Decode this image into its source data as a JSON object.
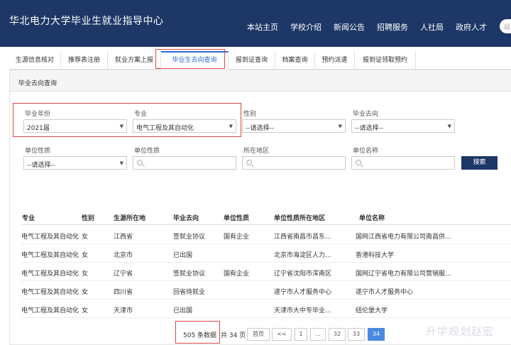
{
  "header": {
    "title": "华北电力大学毕业生就业指导中心",
    "nav": [
      "本站主页",
      "学校介绍",
      "新闻公告",
      "招聘服务",
      "人社局",
      "政府人才"
    ],
    "search_placeholder": "站"
  },
  "tabs": [
    "生源信息核对",
    "推荐表注册",
    "就业方案上报",
    "毕业生去向查询",
    "报到证查询",
    "档案查询",
    "预约派遣",
    "报到证领取预约"
  ],
  "active_tab": 3,
  "panel": {
    "title": "毕业去向查询"
  },
  "filters": {
    "year_label": "毕业年份",
    "year_value": "2021届",
    "major_label": "专业",
    "major_value": "电气工程及其自动化",
    "gender_label": "性别",
    "gender_value": "--请选择--",
    "destination_label": "毕业去向",
    "destination_value": "--请选择--",
    "unit_type_label": "单位性质",
    "unit_type_value": "--请选择--",
    "unit_type2_label": "单位性质",
    "region_label": "所在地区",
    "unit_name_label": "单位名称",
    "search_button": "搜索"
  },
  "table": {
    "headers": [
      "专业",
      "性别",
      "生源所在地",
      "毕业去向",
      "单位性质",
      "单位性质所在地区",
      "单位名称"
    ],
    "rows": [
      [
        "电气工程及其自动化",
        "女",
        "江西省",
        "签就业协议",
        "国有企业",
        "江西省南昌市昌东...",
        "国网江西省电力有限公司南昌供..."
      ],
      [
        "电气工程及其自动化",
        "女",
        "北京市",
        "已出国",
        "",
        "北京市海淀区人力...",
        "香港科技大学"
      ],
      [
        "电气工程及其自动化",
        "女",
        "辽宁省",
        "签就业协议",
        "国有企业",
        "辽宁省沈阳市浑南区",
        "国网辽宁省电力有限公司营销服..."
      ],
      [
        "电气工程及其自动化",
        "女",
        "四川省",
        "回省待就业",
        "",
        "遂宁市人才服务中心",
        "遂宁市人才服务中心"
      ],
      [
        "电气工程及其自动化",
        "女",
        "天津市",
        "已出国",
        "",
        "天津市大中专毕业...",
        "纽伦堡大学"
      ]
    ]
  },
  "pagination": {
    "count": "505 条数据",
    "total": "共 34 页",
    "first": "首页",
    "prev": "<<",
    "pages": [
      "1",
      "...",
      "32",
      "33",
      "34"
    ],
    "current": "34"
  },
  "watermark": "升学规划赵宏",
  "colors": {
    "header_bg": "#1d3766",
    "accent": "#2a6ad8",
    "highlight_box": "#e04848",
    "current_page": "#4a8ae0"
  }
}
